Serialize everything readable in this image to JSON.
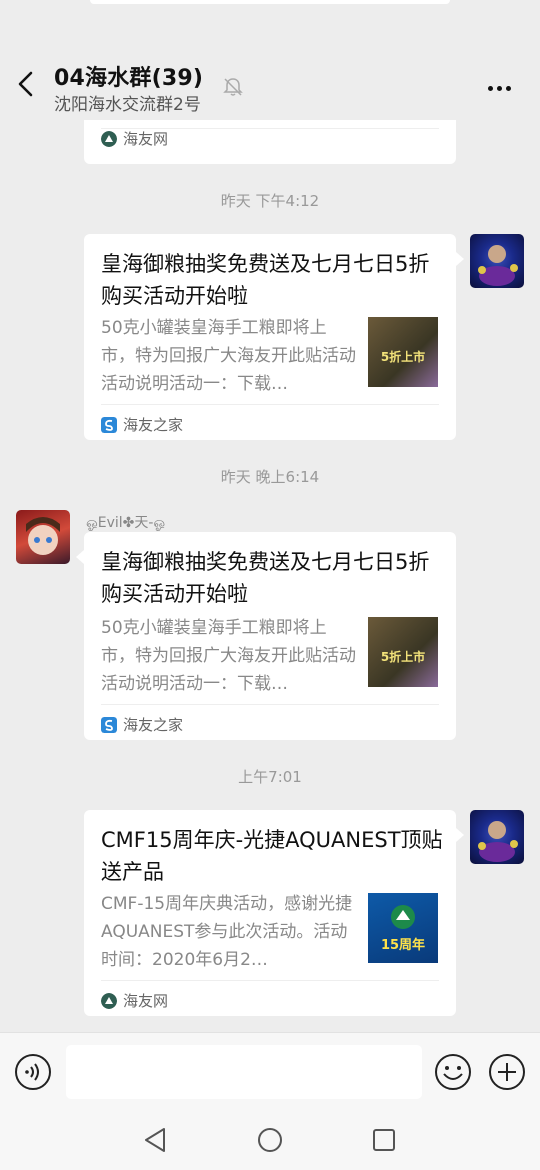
{
  "header": {
    "title": "04海水群(39)",
    "subtitle": "沈阳海水交流群2号"
  },
  "messages": {
    "prev_card": {
      "source": "海友网"
    },
    "time1": "昨天 下午4:12",
    "card1": {
      "title": "皇海御粮抽奖免费送及七月七日5折购买活动开始啦",
      "desc": "50克小罐装皇海手工粮即将上市，特为回报广大海友开此贴活动活动说明活动一：下载…",
      "thumb_text": "5折上市",
      "source": "海友之家"
    },
    "time2": "昨天 晚上6:14",
    "sender2": "ஓEvil✤天-ஓ",
    "card2": {
      "title": "皇海御粮抽奖免费送及七月七日5折购买活动开始啦",
      "desc": "50克小罐装皇海手工粮即将上市，特为回报广大海友开此贴活动活动说明活动一：下载…",
      "thumb_text": "5折上市",
      "source": "海友之家"
    },
    "time3": "上午7:01",
    "card3": {
      "title": "CMF15周年庆-光捷AQUANEST顶贴送产品",
      "desc": "CMF-15周年庆典活动，感谢光捷AQUANEST参与此次活动。活动时间：2020年6月2…",
      "thumb_text": "15周年",
      "source": "海友网"
    }
  },
  "colors": {
    "background": "#ededed",
    "card": "#ffffff",
    "muted_text": "#888888"
  }
}
